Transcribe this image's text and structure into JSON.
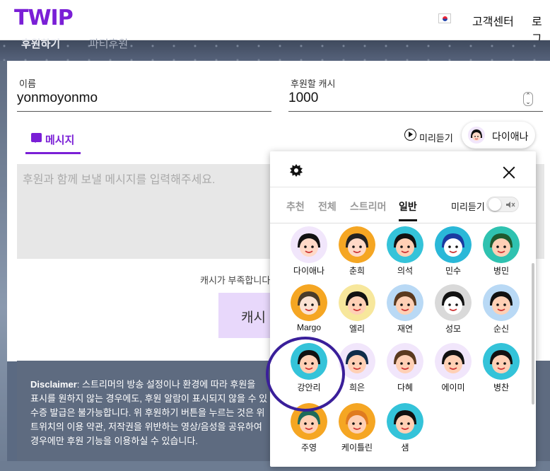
{
  "header": {
    "logo": "TWIP",
    "nav": [
      "고객센터",
      "로그"
    ]
  },
  "band_tabs": [
    "후원하기",
    "파티후원"
  ],
  "form": {
    "name_label": "이름",
    "name_value": "yonmoyonmo",
    "amount_label": "후원할 캐시",
    "amount_value": "1000",
    "message_tab": "메시지",
    "preview_label": "미리듣기",
    "voice_button": "다이애나",
    "message_placeholder": "후원과 함께 보낼 메시지를 입력해주세요.",
    "shortage_text": "캐시가 부족합니다",
    "cash_button": "캐시 ·"
  },
  "disclaimer": {
    "title": "Disclaimer",
    "lines": [
      ": 스트리머의 방송 설정이나 환경에 따라 후원을",
      "표시를 원하지 않는 경우에도, 후원 알람이 표시되지 않을 수 있",
      "수증 발급은 불가능합니다. 위 후원하기 버튼을 누르는 것은 위",
      "트위치의 이용 약관, 저작권을 위반하는 영상/음성을 공유하여",
      "경우에만 후원 기능을 이용하실 수 있습니다."
    ]
  },
  "voice_picker": {
    "tabs": [
      "추천",
      "전체",
      "스트리머",
      "일반"
    ],
    "active_tab": "일반",
    "preview_label": "미리듣기",
    "preview_enabled": false,
    "voices": [
      {
        "name": "다이애나",
        "bg": "#f1e6fb",
        "skin": "#ffd9c7",
        "hair": "#111111"
      },
      {
        "name": "춘희",
        "bg": "#f5a623",
        "skin": "#ffd9c7",
        "hair": "#222222"
      },
      {
        "name": "의석",
        "bg": "#34c3d9",
        "skin": "#ffd0b5",
        "hair": "#111111"
      },
      {
        "name": "민수",
        "bg": "#2ab8d8",
        "skin": "#ffffff",
        "hair": "#1a3aa0"
      },
      {
        "name": "병민",
        "bg": "#2fc2b0",
        "skin": "#ffd0b5",
        "hair": "#1f5a2f"
      },
      {
        "name": "Margo",
        "bg": "#f5a623",
        "skin": "#fbe2d3",
        "hair": "#4a3b2a"
      },
      {
        "name": "엘리",
        "bg": "#f7e79c",
        "skin": "#ffd0b5",
        "hair": "#111111"
      },
      {
        "name": "재연",
        "bg": "#b9d9f5",
        "skin": "#ffd0b5",
        "hair": "#5b3a1f"
      },
      {
        "name": "성모",
        "bg": "#d9d9d9",
        "skin": "#ffffff",
        "hair": "#111111"
      },
      {
        "name": "순신",
        "bg": "#b9d9f5",
        "skin": "#ffd0b5",
        "hair": "#111111"
      },
      {
        "name": "강안리",
        "bg": "#34c3d9",
        "skin": "#ffd0b5",
        "hair": "#111111"
      },
      {
        "name": "희은",
        "bg": "#f1e6fb",
        "skin": "#ffd0b5",
        "hair": "#0f2d4a"
      },
      {
        "name": "다혜",
        "bg": "#f1e6fb",
        "skin": "#ffd0b5",
        "hair": "#5b3a1f"
      },
      {
        "name": "에이미",
        "bg": "#f1e6fb",
        "skin": "#ffd0b5",
        "hair": "#111111"
      },
      {
        "name": "병찬",
        "bg": "#34c3d9",
        "skin": "#ffd0b5",
        "hair": "#111111"
      },
      {
        "name": "주영",
        "bg": "#f5a623",
        "skin": "#ffd0b5",
        "hair": "#1e6b5b"
      },
      {
        "name": "케이틀린",
        "bg": "#f5a623",
        "skin": "#ffd0b5",
        "hair": "#e07b1f"
      },
      {
        "name": "샘",
        "bg": "#34c3d9",
        "skin": "#ffd0b5",
        "hair": "#111111"
      }
    ]
  },
  "colors": {
    "brand": "#7a1fd6",
    "highlight_ring": "#3a1f9a"
  }
}
